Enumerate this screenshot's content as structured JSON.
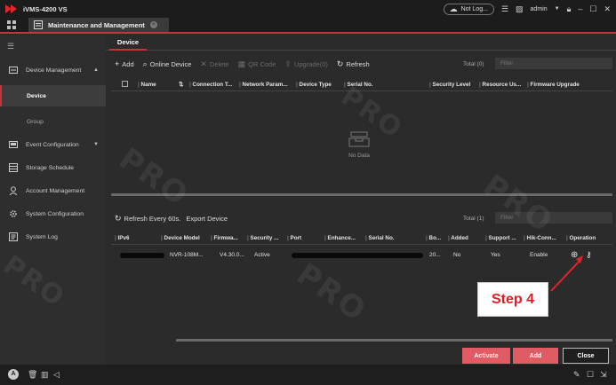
{
  "app": {
    "title": "iVMS-4200 VS",
    "login_label": "Not Log...",
    "user_label": "admin"
  },
  "tab": {
    "label": "Maintenance and Management"
  },
  "sidebar": {
    "items": [
      {
        "label": "Device Management",
        "icon": "device-management-icon"
      },
      {
        "label": "Device",
        "sub": true
      },
      {
        "label": "Group",
        "sub": true
      },
      {
        "label": "Event Configuration",
        "icon": "event-config-icon"
      },
      {
        "label": "Storage Schedule",
        "icon": "storage-schedule-icon"
      },
      {
        "label": "Account Management",
        "icon": "account-icon"
      },
      {
        "label": "System Configuration",
        "icon": "system-config-icon"
      },
      {
        "label": "System Log",
        "icon": "system-log-icon"
      }
    ]
  },
  "content": {
    "subtab": "Device",
    "toolbar": {
      "add": "Add",
      "online_device": "Online Device",
      "delete": "Delete",
      "qr_code": "QR Code",
      "upgrade": "Upgrade(0)",
      "refresh": "Refresh"
    },
    "top_total": "Total (0)",
    "filter_placeholder": "Filter",
    "top_columns": [
      "Name",
      "Connection T...",
      "Network Param...",
      "Device Type",
      "Serial No.",
      "Security Level",
      "Resource Us...",
      "Firmware Upgrade"
    ],
    "no_data": "No Data",
    "online": {
      "refresh": "Refresh Every 60s.",
      "export": "Export Device",
      "total": "Total (1)",
      "columns": [
        "IPv6",
        "Device Model",
        "Firmwa...",
        "Security ...",
        "Port",
        "Enhance...",
        "Serial No.",
        "Bo...",
        "Added",
        "Support ...",
        "Hik-Conn...",
        "Operation"
      ],
      "row": {
        "model": "NVR-108M...",
        "firmware": "V4.30.0...",
        "security": "Active",
        "boot": "20...",
        "added": "No",
        "support": "Yes",
        "hik_connect": "Enable"
      }
    },
    "buttons": {
      "activate": "Activate",
      "add": "Add",
      "close": "Close"
    }
  },
  "annotation": {
    "label": "Step 4",
    "color": "#d91f26"
  },
  "watermark": "PRO SECURITY",
  "colors": {
    "accent": "#c8323c",
    "button_red": "#e05b63"
  }
}
